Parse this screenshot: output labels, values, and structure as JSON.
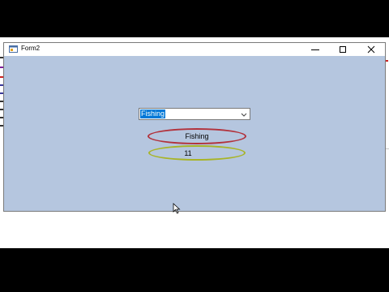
{
  "window": {
    "title": "Form2"
  },
  "combo": {
    "selected": "Fishing"
  },
  "result": {
    "label": "Fishing",
    "count": "11"
  },
  "icons": [
    "app-icon",
    "minimize-icon",
    "maximize-icon",
    "close-icon",
    "dropdown-arrow-icon",
    "mouse-cursor-icon"
  ],
  "colors": {
    "form_background": "#b5c6df",
    "red_oval": "#b2323c",
    "green_oval": "#a8b428",
    "selection": "#0078d7"
  }
}
